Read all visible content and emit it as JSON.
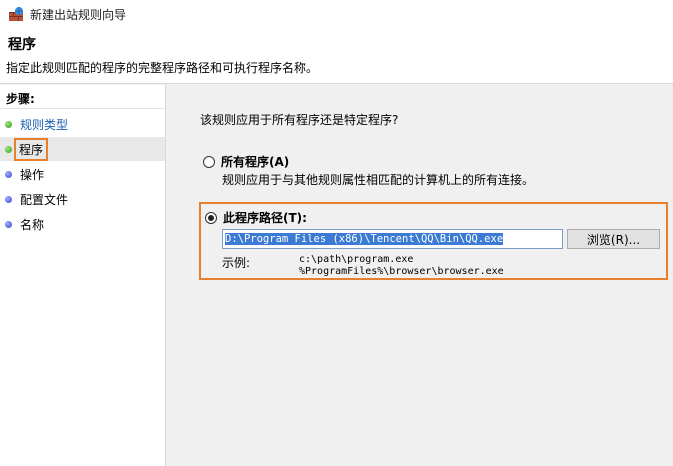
{
  "window": {
    "title": "新建出站规则向导"
  },
  "header": {
    "title": "程序",
    "subtitle": "指定此规则匹配的程序的完整程序路径和可执行程序名称。"
  },
  "sidebar": {
    "steps_label": "步骤:",
    "items": [
      {
        "label": "规则类型",
        "status": "done"
      },
      {
        "label": "程序",
        "status": "current"
      },
      {
        "label": "操作",
        "status": "pending"
      },
      {
        "label": "配置文件",
        "status": "pending"
      },
      {
        "label": "名称",
        "status": "pending"
      }
    ]
  },
  "main": {
    "question": "该规则应用于所有程序还是特定程序?",
    "option_all": {
      "label": "所有程序(A)",
      "description": "规则应用于与其他规则属性相匹配的计算机上的所有连接。",
      "checked": false
    },
    "option_path": {
      "label": "此程序路径(T):",
      "checked": true,
      "value": "D:\\Program Files (x86)\\Tencent\\QQ\\Bin\\QQ.exe",
      "browse_label": "浏览(R)...",
      "example_label": "示例:",
      "example_line1": "c:\\path\\program.exe",
      "example_line2": "%ProgramFiles%\\browser\\browser.exe"
    }
  },
  "colors": {
    "highlight_box": "#e87f2c",
    "link": "#1a5fb4",
    "done_dot": "#2f9e1a",
    "pending_dot": "#3340c9"
  }
}
